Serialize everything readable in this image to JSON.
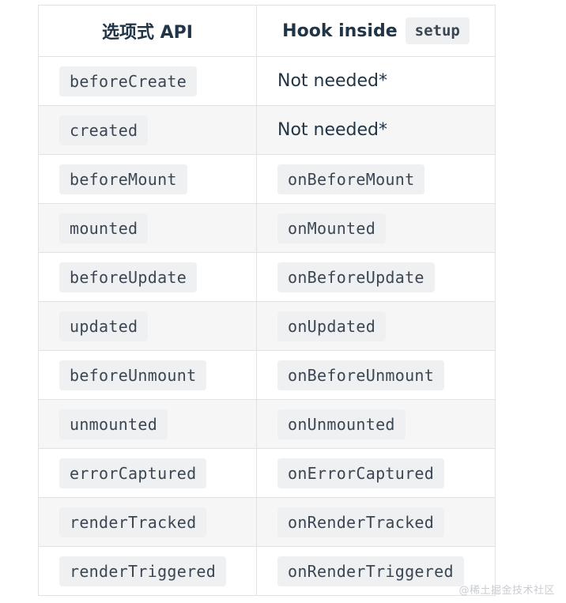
{
  "table": {
    "headers": {
      "options_api": "选项式 API",
      "hook_prefix": "Hook inside",
      "hook_code": "setup"
    },
    "rows": [
      {
        "option": "beforeCreate",
        "hook": "Not needed*",
        "hook_is_code": false
      },
      {
        "option": "created",
        "hook": "Not needed*",
        "hook_is_code": false
      },
      {
        "option": "beforeMount",
        "hook": "onBeforeMount",
        "hook_is_code": true
      },
      {
        "option": "mounted",
        "hook": "onMounted",
        "hook_is_code": true
      },
      {
        "option": "beforeUpdate",
        "hook": "onBeforeUpdate",
        "hook_is_code": true
      },
      {
        "option": "updated",
        "hook": "onUpdated",
        "hook_is_code": true
      },
      {
        "option": "beforeUnmount",
        "hook": "onBeforeUnmount",
        "hook_is_code": true
      },
      {
        "option": "unmounted",
        "hook": "onUnmounted",
        "hook_is_code": true
      },
      {
        "option": "errorCaptured",
        "hook": "onErrorCaptured",
        "hook_is_code": true
      },
      {
        "option": "renderTracked",
        "hook": "onRenderTracked",
        "hook_is_code": true
      },
      {
        "option": "renderTriggered",
        "hook": "onRenderTriggered",
        "hook_is_code": true
      }
    ]
  },
  "watermark": "@稀土掘金技术社区",
  "colors": {
    "text": "#213547",
    "code_bg": "#eef0f2",
    "border": "#e2e2e3",
    "stripe": "#f6f6f7"
  }
}
